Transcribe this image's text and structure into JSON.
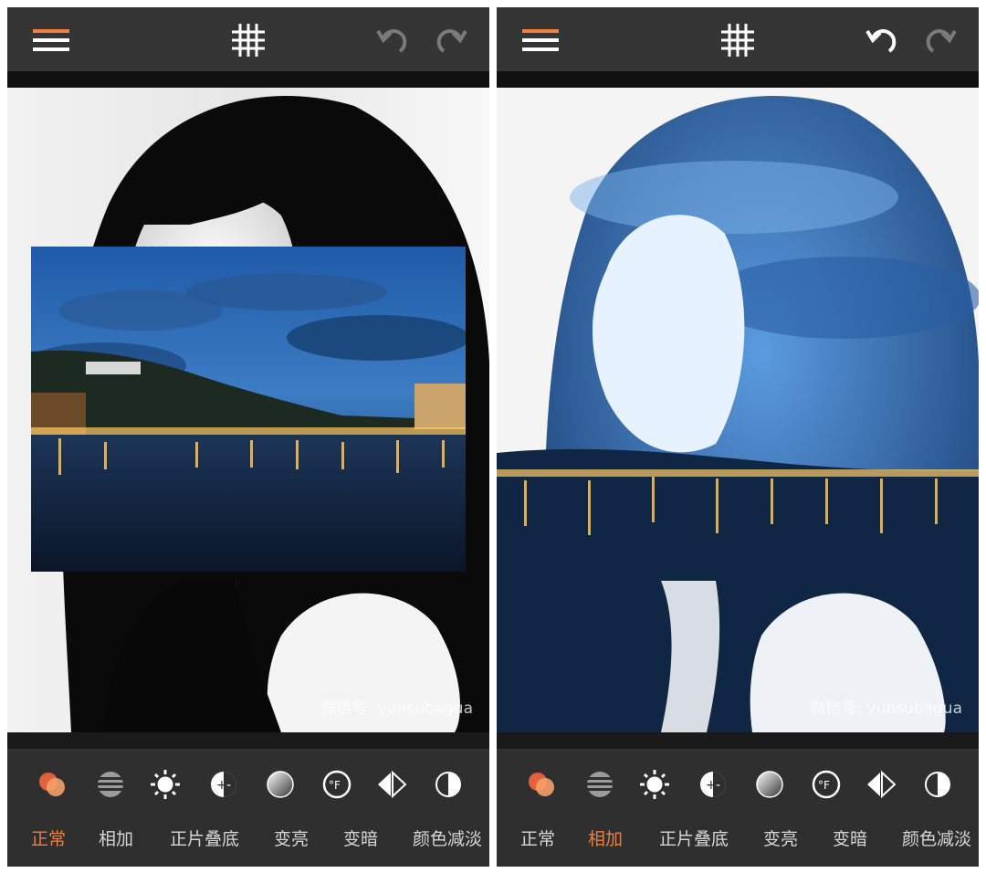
{
  "watermark_text": "微信号: yunsubagua",
  "accent_color": "#f07f3c",
  "icons": {
    "menu": "hamburger-menu-icon",
    "grid": "grid-icon",
    "undo": "undo-arrow-icon",
    "redo": "redo-arrow-icon",
    "modes": [
      "overlap-circles-icon",
      "stripes-sphere-icon",
      "sun-icon",
      "plus-minus-circle-icon",
      "gradient-sphere-icon",
      "fahrenheit-circle-icon",
      "split-diamond-icon",
      "half-circle-icon"
    ]
  },
  "panels": [
    {
      "undo_enabled": false,
      "redo_enabled": false,
      "blend_modes": [
        {
          "label": "正常",
          "active": true
        },
        {
          "label": "相加",
          "active": false
        },
        {
          "label": "正片叠底",
          "active": false
        },
        {
          "label": "变亮",
          "active": false
        },
        {
          "label": "变暗",
          "active": false
        },
        {
          "label": "颜色减淡",
          "active": false
        }
      ]
    },
    {
      "undo_enabled": true,
      "redo_enabled": false,
      "blend_modes": [
        {
          "label": "正常",
          "active": false
        },
        {
          "label": "相加",
          "active": true
        },
        {
          "label": "正片叠底",
          "active": false
        },
        {
          "label": "变亮",
          "active": false
        },
        {
          "label": "变暗",
          "active": false
        },
        {
          "label": "颜色减淡",
          "active": false
        }
      ]
    }
  ]
}
